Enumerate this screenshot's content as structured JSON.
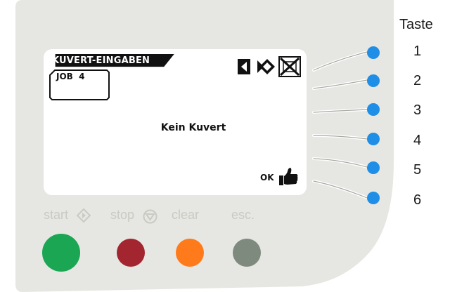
{
  "display": {
    "title": "KUVERT-EINGABEN",
    "job_label": "JOB",
    "job_number": "4",
    "message": "Kein Kuvert",
    "ok_label": "OK",
    "status_icons": [
      "arrow-left-icon",
      "arrow-right-diamond-icon",
      "envelope-crossed-icon"
    ]
  },
  "side_keys": {
    "header": "Taste",
    "numbers": [
      "1",
      "2",
      "3",
      "4",
      "5",
      "6"
    ]
  },
  "control_buttons": [
    {
      "label": "start",
      "icon": "start-diamond-icon",
      "color": "#1aa652"
    },
    {
      "label": "stop",
      "icon": "stop-triangle-icon",
      "color": "#a3252f"
    },
    {
      "label": "clear",
      "icon": null,
      "color": "#ff7a1a"
    },
    {
      "label": "esc.",
      "icon": null,
      "color": "#7f8a7e"
    }
  ],
  "colors": {
    "panel": "#e6e7e2",
    "key_dot": "#1e8ee6",
    "hint_text": "#c9cac4"
  }
}
